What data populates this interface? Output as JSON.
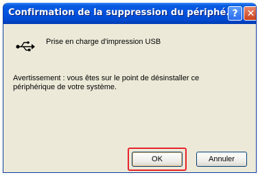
{
  "dialog": {
    "title": "Confirmation de la suppression du périphé...",
    "help_symbol": "?",
    "close_symbol": "✕",
    "device_label": "Prise en charge d'impression USB",
    "warning_text": "Avertissement : vous êtes sur le point de désinstaller ce périphérique de votre système.",
    "ok_label": "OK",
    "cancel_label": "Annuler",
    "device_icon": "usb-icon"
  },
  "colors": {
    "titlebar": "#0054e3",
    "body": "#ece9d8",
    "highlight": "#e8222a"
  }
}
